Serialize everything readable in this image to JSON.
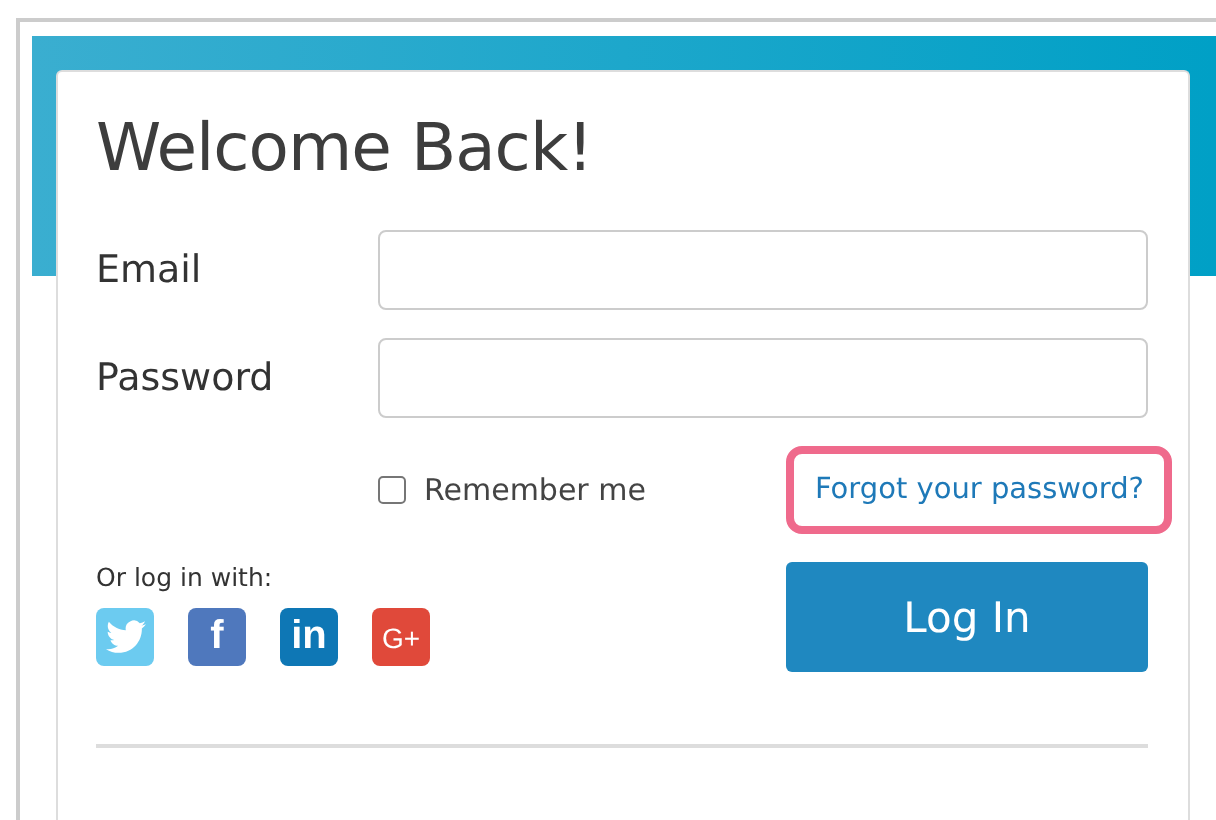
{
  "title": "Welcome Back!",
  "fields": [
    {
      "label": "Email"
    },
    {
      "label": "Password"
    }
  ],
  "remember": {
    "label": "Remember me",
    "checked": false
  },
  "forgot_link": {
    "label": "Forgot your password?",
    "highlighted": true
  },
  "social": {
    "label": "Or log in with:",
    "items": [
      {
        "kind": "twitter"
      },
      {
        "kind": "facebook",
        "glyph": "f"
      },
      {
        "kind": "linkedin",
        "glyph": "in"
      },
      {
        "kind": "google",
        "glyph": "G+"
      }
    ]
  },
  "login_button": "Log In"
}
